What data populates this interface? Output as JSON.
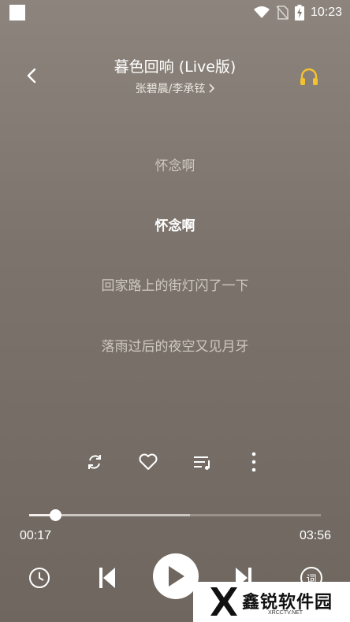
{
  "status_bar": {
    "time": "10:23"
  },
  "header": {
    "title": "暮色回响 (Live版)",
    "artist": "张碧晨/李承铉"
  },
  "lyrics": [
    {
      "text": "怀念啊",
      "current": false
    },
    {
      "text": "怀念啊",
      "current": true
    },
    {
      "text": "回家路上的街灯闪了一下",
      "current": false
    },
    {
      "text": "落雨过后的夜空又见月牙",
      "current": false
    }
  ],
  "actions": [
    "repeat-icon",
    "heart-icon",
    "playlist-add-icon",
    "more-icon"
  ],
  "player": {
    "elapsed": "00:17",
    "duration": "03:56",
    "progress_fraction": 0.09,
    "buffered_fraction": 0.55
  },
  "controls": [
    "timer-icon",
    "previous-icon",
    "play-icon",
    "next-icon",
    "lyrics-icon"
  ],
  "lyrics_button_glyph": "词",
  "watermark": {
    "text": "鑫锐软件园",
    "sub": "XRCCTV.NET"
  },
  "colors": {
    "background": "#7c746c",
    "accent": "#ffffff",
    "headphone": "#f2c230"
  }
}
